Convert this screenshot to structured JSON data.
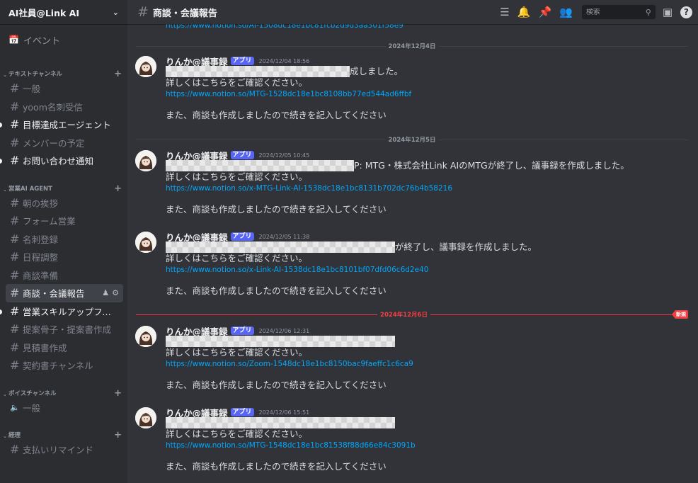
{
  "server": {
    "name": "AI社員@Link AI"
  },
  "events_label": "イベント",
  "categories": [
    {
      "title": "テキストチャンネル",
      "channels": [
        {
          "label": "一般",
          "unread": false
        },
        {
          "label": "yoom名刺受信",
          "unread": false
        },
        {
          "label": "目標達成エージェント",
          "unread": true
        },
        {
          "label": "メンバーの予定",
          "unread": false
        },
        {
          "label": "お問い合わせ通知",
          "unread": true
        }
      ]
    },
    {
      "title": "営業AI AGENT",
      "channels": [
        {
          "label": "朝の挨拶",
          "unread": false
        },
        {
          "label": "フォーム営業",
          "unread": false
        },
        {
          "label": "名刺登録",
          "unread": false
        },
        {
          "label": "日程調整",
          "unread": false
        },
        {
          "label": "商談準備",
          "unread": false
        },
        {
          "label": "商談・会議報告",
          "unread": false,
          "active": true
        },
        {
          "label": "営業スキルアップフィ...",
          "unread": true
        },
        {
          "label": "提案骨子・提案書作成",
          "unread": false
        },
        {
          "label": "見積書作成",
          "unread": false
        },
        {
          "label": "契約書チャンネル",
          "unread": false
        }
      ]
    },
    {
      "title": "ボイスチャンネル",
      "channels": [
        {
          "label": "一般",
          "unread": false,
          "voice": true
        }
      ]
    },
    {
      "title": "経理",
      "channels": [
        {
          "label": "支払いリマインド",
          "unread": false
        }
      ]
    }
  ],
  "header": {
    "channel": "商談・会議報告",
    "search_placeholder": "検索"
  },
  "colors": {
    "accent": "#5865f2",
    "link": "#00a8fc",
    "new_marker": "#f23f43"
  },
  "chat": {
    "prev_link": "https://www.notion.so/AI-1508dc18e1bc81fcb2d9d3aa301f58e9",
    "dividers": [
      {
        "text": "2024年12月4日"
      },
      {
        "text": "2024年12月5日"
      },
      {
        "text": "2024年12月6日",
        "new_label": "新規"
      }
    ],
    "messages": [
      {
        "user": "りんか@議事録",
        "badge": "アプリ",
        "time": "2024/12/04 18:56",
        "line1_tail": "成しました。",
        "line2": "詳しくはこちらをご確認ください。",
        "link": "https://www.notion.so/MTG-1528dc18e1bc8108bb77ed544ad6ffbf",
        "follow": "また、商談も作成しましたので続きを記入してください"
      },
      {
        "user": "りんか@議事録",
        "badge": "アプリ",
        "time": "2024/12/05 10:45",
        "line1_tail": "P: MTG・株式会社Link AIのMTGが終了し、議事録を作成しました。",
        "line2": "詳しくはこちらをご確認ください。",
        "link": "https://www.notion.so/x-MTG-Link-AI-1538dc18e1bc8131b702dc76b4b58216",
        "follow": "また、商談も作成しましたので続きを記入してください"
      },
      {
        "user": "りんか@議事録",
        "badge": "アプリ",
        "time": "2024/12/05 11:38",
        "line1_tail": "が終了し、議事録を作成しました。",
        "line2": "詳しくはこちらをご確認ください。",
        "link": "https://www.notion.so/x-Link-AI-1538dc18e1bc8101bf07dfd06c6d2e40",
        "follow": "また、商談も作成しましたので続きを記入してください"
      },
      {
        "user": "りんか@議事録",
        "badge": "アプリ",
        "time": "2024/12/06 12:31",
        "line1_tail": "",
        "line2": "詳しくはこちらをご確認ください。",
        "link": "https://www.notion.so/Zoom-1548dc18e1bc8150bac9faeffc1c6ca9",
        "follow": "また、商談も作成しましたので続きを記入してください"
      },
      {
        "user": "りんか@議事録",
        "badge": "アプリ",
        "time": "2024/12/06 15:51",
        "line1_tail": "",
        "line2": "詳しくはこちらをご確認ください。",
        "link": "https://www.notion.so/MTG-1548dc18e1bc81538f88d66e84c3091b",
        "follow": "また、商談も作成しましたので続きを記入してください"
      }
    ]
  }
}
